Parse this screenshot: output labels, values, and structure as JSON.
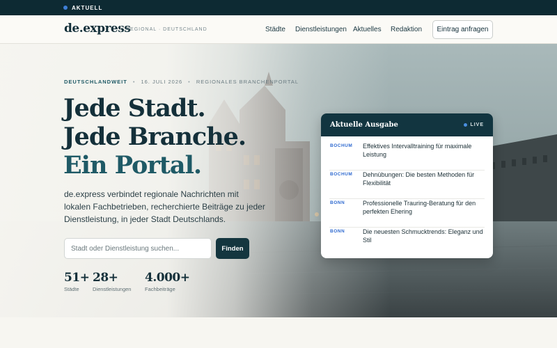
{
  "topbar": {
    "label": "AKTUELL",
    "dot_color": "#3f7fd6"
  },
  "nav": {
    "logo": "de.express",
    "tagline": "REGIONAL · DEUTSCHLAND",
    "links": [
      "Städte",
      "Dienstleistungen",
      "Aktuelles",
      "Redaktion"
    ],
    "cta": "Eintrag anfragen"
  },
  "hero": {
    "meta": {
      "scope": "DEUTSCHLANDWEIT",
      "date": "16. JULI 2026",
      "type": "REGIONALES BRANCHENPORTAL"
    },
    "headline": {
      "line1": "Jede Stadt.",
      "line2": "Jede Branche.",
      "line3": "Ein Portal."
    },
    "lead": "de.express verbindet regionale Nachrichten mit lokalen Fachbetrieben, recherchierte Beiträge zu jeder Dienstleistung, in jeder Stadt Deutschlands.",
    "search": {
      "placeholder": "Stadt oder Dienstleistung suchen...",
      "button": "Finden"
    },
    "stats": [
      {
        "value": "51+",
        "label": "Städte"
      },
      {
        "value": "28+",
        "label": "Dienstleistungen"
      },
      {
        "value": "4.000+",
        "label": "Fachbeiträge"
      }
    ]
  },
  "card": {
    "title": "Aktuelle Ausgabe",
    "live_label": "LIVE",
    "items": [
      {
        "city": "BOCHUM",
        "title": "Effektives Intervalltraining für maximale Leistung"
      },
      {
        "city": "BOCHUM",
        "title": "Dehnübungen: Die besten Methoden für Flexibilität"
      },
      {
        "city": "BONN",
        "title": "Professionelle Trauring-Beratung für den perfekten Ehering"
      },
      {
        "city": "BONN",
        "title": "Die neuesten Schmucktrends: Eleganz und Stil"
      }
    ]
  },
  "colors": {
    "primary": "#14303a",
    "accent": "#1f5a66",
    "city_link": "#2f6ad0",
    "background": "#f7f6f1"
  }
}
